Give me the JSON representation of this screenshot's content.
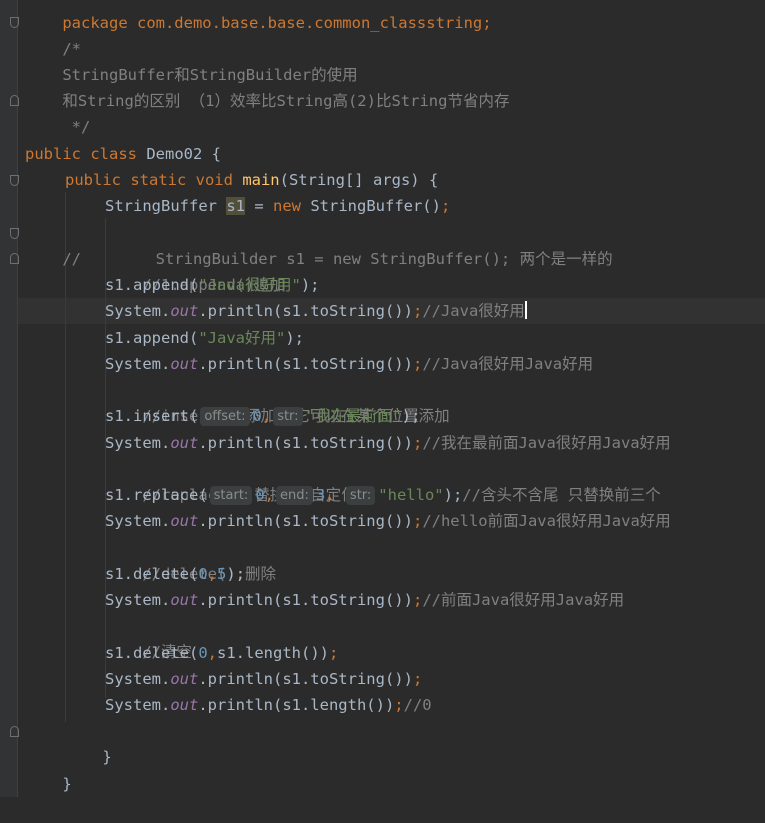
{
  "editor": {
    "package_line": "package com.demo.base.base.common_classstring;",
    "lines": {
      "doc_open": "/*",
      "doc_1": "StringBuffer和StringBuilder的使用",
      "doc_2": "和String的区别 （1）效率比String高(2)比String节省内存",
      "doc_close": " */",
      "class_kw": "public class ",
      "class_name": "Demo02 {",
      "main_kw": "public static void ",
      "main_name": "main",
      "main_args": "(String[] args) {",
      "sb_type": "StringBuffer ",
      "sb_var": "s1",
      "sb_eq": " = ",
      "sb_new": "new ",
      "sb_ctor": "StringBuffer()",
      "sb_semi": ";",
      "commented": "//        StringBuilder s1 = new StringBuffer(); 两个是一样的",
      "c_append": "//1.append()追加",
      "append1_pre": "s1.append(",
      "append1_str": "\"Java很好用\"",
      "append1_post": ");",
      "println1_pre": "System.",
      "println_out": "out",
      "println1_mid": ".println(s1.toString())",
      "println_semi": ";",
      "println1_com": "//Java很好用",
      "append2_pre": "s1.append(",
      "append2_str": "\"Java好用\"",
      "append2_post": ");",
      "println2_com": "//Java很好用Java好用",
      "c_insert": "//insert();添加  它可以在某个位置添加",
      "insert_pre": "s1.insert(",
      "hint_offset": "offset:",
      "insert_num": "0",
      "comma": ",",
      "hint_str": "str:",
      "insert_str": "\"我在最前面\"",
      "insert_post": ");",
      "println3_com": "//我在最前面Java很好用Java好用",
      "c_replace": "//replace();替换 可自定位置",
      "replace_pre": "s1.replace(",
      "hint_start": "start:",
      "replace_n1": "0",
      "hint_end": "end:",
      "replace_n2": "3",
      "replace_str": "\"hello\"",
      "replace_post": ");",
      "replace_com": "//含头不含尾 只替换前三个",
      "println4_com": "//hello前面Java很好用Java好用",
      "c_delete": "//delete();删除",
      "delete_pre": "s1.delete(",
      "delete_n1": "0",
      "delete_n2": "5",
      "delete_post": ");",
      "println5_com": "//前面Java很好用Java好用",
      "c_clear": "//清空",
      "clear_pre": "s1.delete(",
      "clear_n": "0",
      "clear_mid": "s1.length())",
      "clear_semi": ";",
      "println6_mid": ".println(s1.toString())",
      "println7_mid": ".println(s1.length())",
      "println7_com": "//0",
      "close_main": "}",
      "close_class": "}"
    }
  },
  "colors": {
    "background": "#2b2b2b",
    "keyword": "#cc7832",
    "string": "#6a8759",
    "number": "#6897bb",
    "comment": "#808080",
    "method_decl": "#ffc66d",
    "static_field": "#9876aa"
  }
}
